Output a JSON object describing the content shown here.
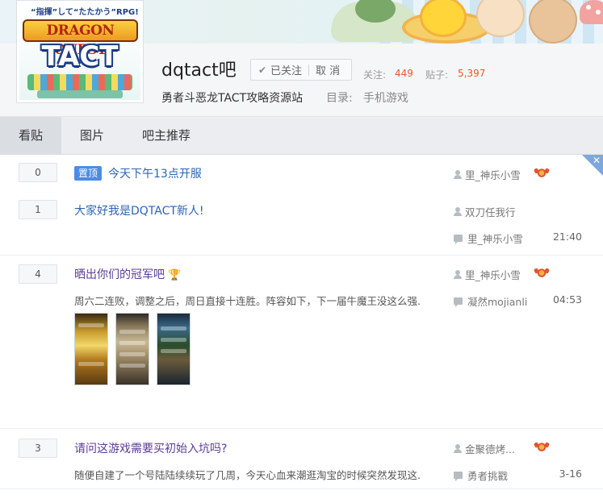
{
  "banner": {
    "tagline": "“指揮”して“たたかう”RPG!",
    "logo_line1": "DRAGON QUEST",
    "logo_line2": "TACT"
  },
  "forum": {
    "name": "dqtact吧",
    "follow_label": "已关注",
    "unfollow_label": "取 消",
    "followers_label": "关注:",
    "followers_value": "449",
    "posts_label": "贴子:",
    "posts_value": "5,397",
    "slogan": "勇者斗恶龙TACT攻略资源站",
    "directory_label": "目录:",
    "directory_value": "手机游戏"
  },
  "tabs": [
    {
      "label": "看贴",
      "active": true
    },
    {
      "label": "图片",
      "active": false
    },
    {
      "label": "吧主推荐",
      "active": false
    }
  ],
  "threads": [
    {
      "replies": "0",
      "pinned_label": "置顶",
      "title": "今天下午13点开服",
      "author": "里_神乐小雪",
      "has_medal": true
    },
    {
      "replies": "1",
      "title": "大家好我是DQTACT新人!",
      "author": "双刀任我行",
      "last_replier": "里_神乐小雪",
      "time": "21:40"
    },
    {
      "replies": "4",
      "title": "晒出你们的冠军吧",
      "title_icon": "trophy-icon",
      "abstract": "周六二连败，调整之后，周日直接十连胜。阵容如下，下一届牛魔王没这么强...",
      "author": "里_神乐小雪",
      "has_medal": true,
      "last_replier": "凝然mojianli",
      "time": "04:53",
      "thumbnails": [
        "screenshot-thumbnail",
        "screenshot-thumbnail",
        "screenshot-thumbnail"
      ]
    },
    {
      "replies": "3",
      "title": "请问这游戏需要买初始入坑吗?",
      "abstract": "随便自建了一个号陆陆续续玩了几周，今天心血来潮逛淘宝的时候突然发现这...",
      "author": "金聚德烤...",
      "has_medal": true,
      "last_replier": "勇者挑戳",
      "time": "3-16"
    }
  ],
  "colors": {
    "link": "#2d64b3",
    "visited_link": "#5b3c97",
    "stat_value": "#e8592b",
    "pin_badge": "#4a8ce8",
    "tab_bar": "#ebedf0",
    "tab_active": "#dadde1"
  }
}
